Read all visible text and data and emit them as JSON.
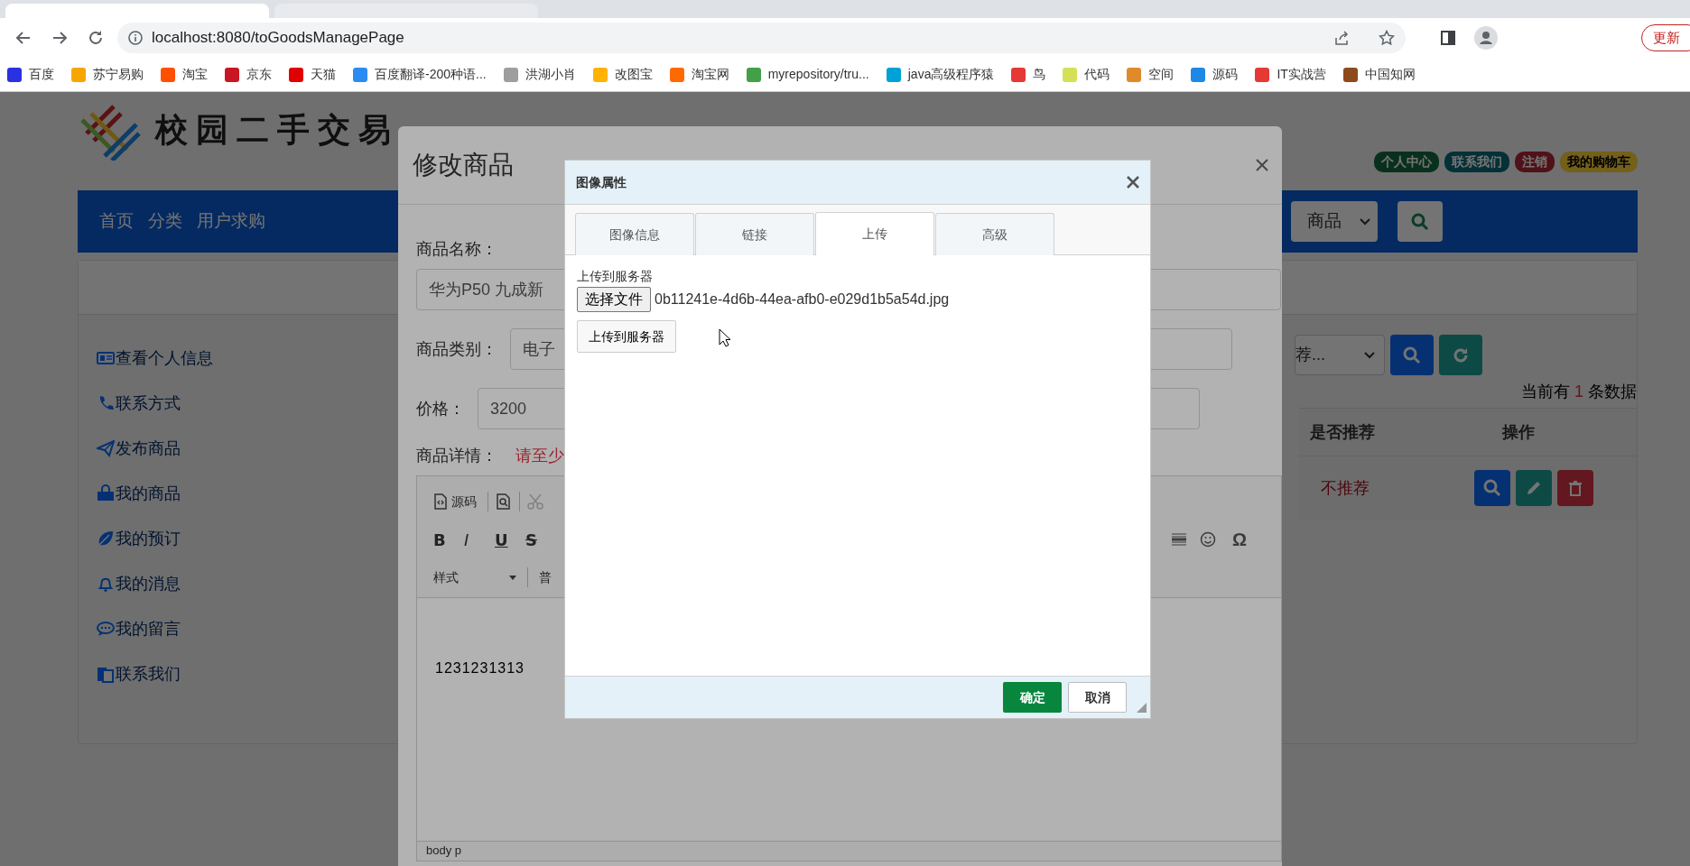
{
  "browser": {
    "url": "localhost:8080/toGoodsManagePage",
    "update_button": "更新",
    "bookmarks": [
      {
        "label": "百度",
        "color": "#2932e1"
      },
      {
        "label": "苏宁易购",
        "color": "#f7a600"
      },
      {
        "label": "淘宝",
        "color": "#ff5000"
      },
      {
        "label": "京东",
        "color": "#c91623"
      },
      {
        "label": "天猫",
        "color": "#e00000"
      },
      {
        "label": "百度翻译-200种语...",
        "color": "#2a8cf0"
      },
      {
        "label": "洪湖小肖",
        "color": "#9e9e9e"
      },
      {
        "label": "改图宝",
        "color": "#ffb300"
      },
      {
        "label": "淘宝网",
        "color": "#ff6a00"
      },
      {
        "label": "myrepository/tru...",
        "color": "#43a047"
      },
      {
        "label": "java高级程序猿",
        "color": "#00a1d6"
      },
      {
        "label": "鸟",
        "color": "#e53935"
      },
      {
        "label": "代码",
        "color": "#d4e157"
      },
      {
        "label": "空间",
        "color": "#e08a2c"
      },
      {
        "label": "源码",
        "color": "#1e88e5"
      },
      {
        "label": "IT实战营",
        "color": "#e53935"
      },
      {
        "label": "中国知网",
        "color": "#8d4a1c"
      }
    ]
  },
  "site": {
    "logo_text": "校园二手交易",
    "badges": [
      {
        "label": "个人中心",
        "kind": "success"
      },
      {
        "label": "联系我们",
        "kind": "info"
      },
      {
        "label": "注销",
        "kind": "danger"
      },
      {
        "label": "我的购物车",
        "kind": "warning"
      }
    ],
    "nav_links": [
      "首页",
      "分类",
      "用户求购"
    ],
    "search_select": "商品",
    "sidebar": [
      "查看个人信息",
      "联系方式",
      "发布商品",
      "我的商品",
      "我的预订",
      "我的消息",
      "我的留言",
      "联系我们"
    ],
    "filter_select": "荐...",
    "count": {
      "prefix": "当前有",
      "number": "1",
      "suffix": "条数据"
    },
    "table": {
      "columns": [
        "是否推荐",
        "操作"
      ],
      "rows": [
        {
          "recommend": "不推荐"
        }
      ]
    }
  },
  "modal": {
    "title": "修改商品",
    "fields": [
      {
        "label": "商品名称：",
        "value": "华为P50 九成新",
        "kind": "stacked"
      },
      {
        "label": "商品类别：",
        "value": "电子",
        "kind": "inline"
      },
      {
        "label": "价格：",
        "value": "3200",
        "kind": "inline"
      }
    ],
    "details_label": "商品详情：",
    "details_hint": "请至少",
    "editor": {
      "source_button": "源码",
      "format_buttons": [
        "B",
        "I",
        "U",
        "S"
      ],
      "symbol_button": "Ω",
      "style_dropdown": "样式",
      "format_dropdown": "普",
      "content": "1231231313",
      "path": "body p"
    }
  },
  "dialog": {
    "title": "图像属性",
    "tabs": [
      {
        "label": "图像信息",
        "selected": false
      },
      {
        "label": "链接",
        "selected": false
      },
      {
        "label": "上传",
        "selected": true
      },
      {
        "label": "高级",
        "selected": false
      }
    ],
    "upload_label": "上传到服务器",
    "file_button": "选择文件",
    "file_name": "0b11241e-4d6b-44ea-afb0-e029d1b5a54d.jpg",
    "upload_button": "上传到服务器",
    "ok_button": "确定",
    "cancel_button": "取消"
  }
}
